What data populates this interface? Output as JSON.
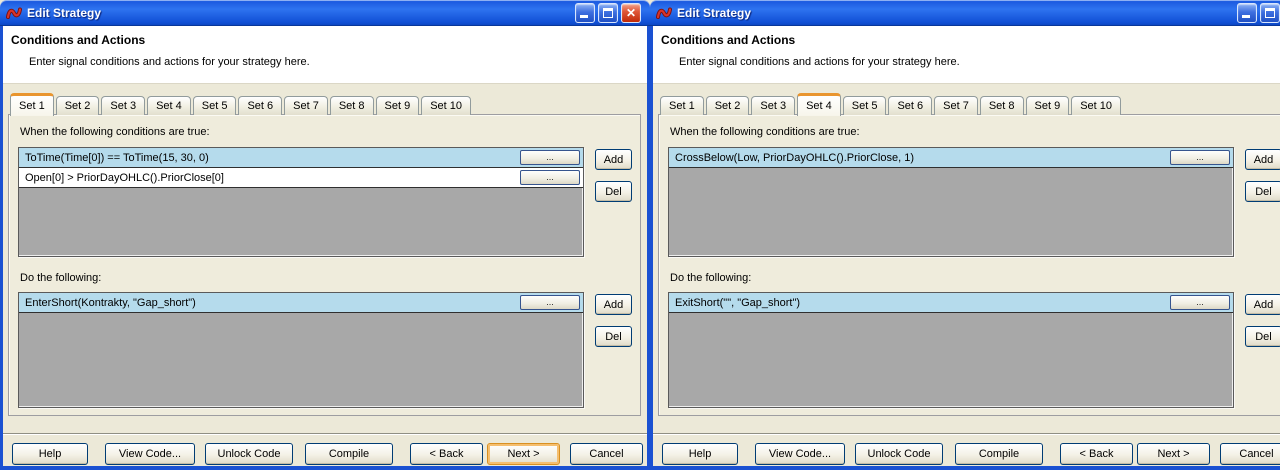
{
  "palette": {
    "titlebar_blue": "#1C5AE0",
    "window_border_blue": "#1A51D2",
    "dialog_background": "#ECE9D8",
    "selected_row_blue": "#B5DBEC",
    "listbox_gray": "#A8A8A8",
    "active_tab_accent_orange": "#E9952E",
    "focused_button_ring_orange": "#F5BE6E"
  },
  "icons": {
    "close_glyph": "✕"
  },
  "windows": [
    {
      "title": "Edit Strategy",
      "header": {
        "title": "Conditions and Actions",
        "subtitle": "Enter signal conditions and actions for your strategy here."
      },
      "tabs": [
        "Set 1",
        "Set 2",
        "Set 3",
        "Set 4",
        "Set 5",
        "Set 6",
        "Set 7",
        "Set 8",
        "Set 9",
        "Set 10"
      ],
      "active_tab": "Set 1",
      "conditions_label": "When the following conditions are true:",
      "conditions": [
        {
          "text": "ToTime(Time[0]) == ToTime(15, 30, 0)",
          "selected": true
        },
        {
          "text": "Open[0] > PriorDayOHLC().PriorClose[0]",
          "selected": false
        }
      ],
      "actions_label": "Do the following:",
      "actions": [
        {
          "text": "EnterShort(Kontrakty, \"Gap_short\")",
          "selected": true
        }
      ],
      "more_label": "...",
      "add_label": "Add",
      "del_label": "Del",
      "footer_buttons": [
        "Help",
        "View Code...",
        "Unlock Code",
        "Compile",
        "< Back",
        "Next >",
        "Cancel"
      ],
      "focused_button": "Next >"
    },
    {
      "title": "Edit Strategy",
      "header": {
        "title": "Conditions and Actions",
        "subtitle": "Enter signal conditions and actions for your strategy here."
      },
      "tabs": [
        "Set 1",
        "Set 2",
        "Set 3",
        "Set 4",
        "Set 5",
        "Set 6",
        "Set 7",
        "Set 8",
        "Set 9",
        "Set 10"
      ],
      "active_tab": "Set 4",
      "conditions_label": "When the following conditions are true:",
      "conditions": [
        {
          "text": "CrossBelow(Low, PriorDayOHLC().PriorClose, 1)",
          "selected": true
        }
      ],
      "actions_label": "Do the following:",
      "actions": [
        {
          "text": "ExitShort(\"\", \"Gap_short\")",
          "selected": true
        }
      ],
      "more_label": "...",
      "add_label": "Add",
      "del_label": "Del",
      "footer_buttons": [
        "Help",
        "View Code...",
        "Unlock Code",
        "Compile",
        "< Back",
        "Next >",
        "Cancel"
      ],
      "focused_button": null
    }
  ]
}
